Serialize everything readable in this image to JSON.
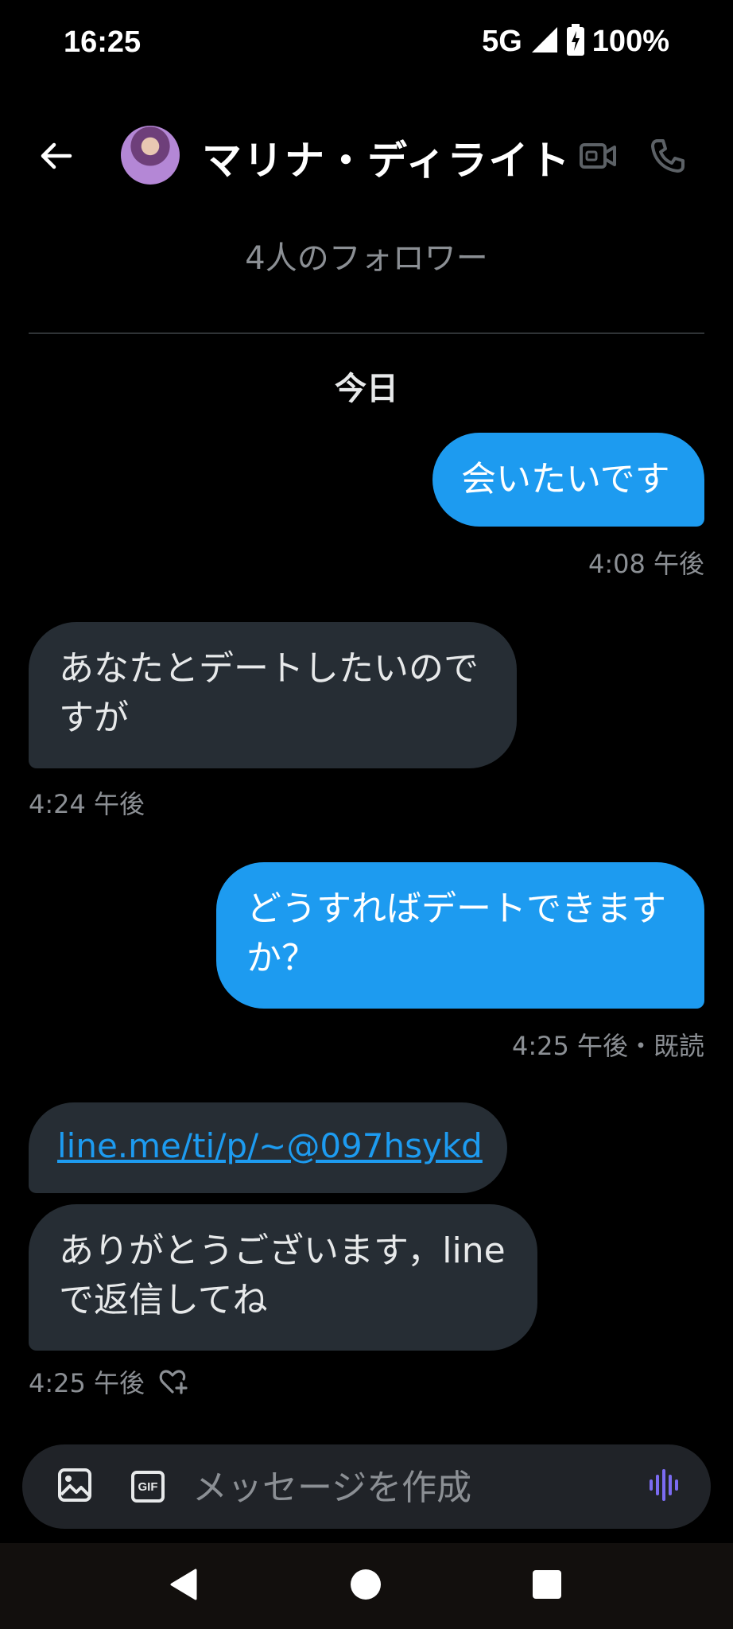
{
  "status_bar": {
    "time": "16:25",
    "network": "5G",
    "battery": "100%"
  },
  "header": {
    "name": "マリナ・ディライト",
    "followers": "4人のフォロワー"
  },
  "date_separator": "今日",
  "messages": [
    {
      "side": "sent",
      "text": "会いたいです",
      "meta": "4:08 午後"
    },
    {
      "side": "recv",
      "text": "あなたとデートしたいのですが",
      "meta": "4:24 午後"
    },
    {
      "side": "sent",
      "text": "どうすればデートできますか？",
      "meta": "4:25 午後・既読"
    },
    {
      "side": "recv",
      "text": "line.me/ti/p/~@097hsykd",
      "is_link": true
    },
    {
      "side": "recv",
      "text": "ありがとうございます，lineで返信してね",
      "meta": "4:25 午後"
    }
  ],
  "composer": {
    "placeholder": "メッセージを作成",
    "gif_label": "GIF"
  },
  "colors": {
    "background": "#000000",
    "sent_bubble": "#1D9BF0",
    "received_bubble": "#262D34",
    "secondary_text": "#8B8F94",
    "link": "#1D9BF0",
    "voice_accent": "#7B6BF2"
  },
  "icons": {
    "back": "back-arrow-icon",
    "video": "video-camera-icon",
    "phone": "phone-icon",
    "image": "image-icon",
    "gif": "gif-icon",
    "voice": "voice-wave-icon",
    "reaction": "heart-plus-icon"
  }
}
